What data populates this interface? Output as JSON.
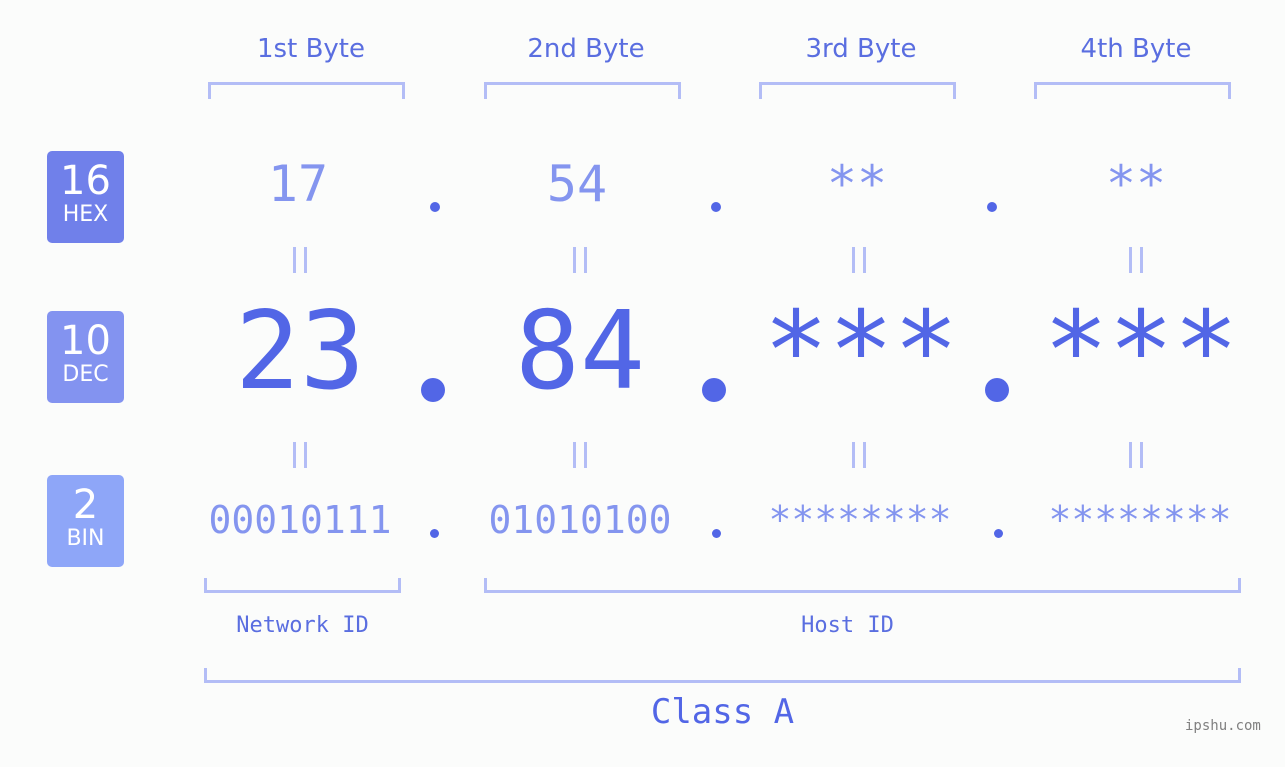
{
  "headers": [
    "1st Byte",
    "2nd Byte",
    "3rd Byte",
    "4th Byte"
  ],
  "badges": {
    "hex": {
      "num": "16",
      "label": "HEX",
      "color": "#7080ea"
    },
    "dec": {
      "num": "10",
      "label": "DEC",
      "color": "#8393f0"
    },
    "bin": {
      "num": "2",
      "label": "BIN",
      "color": "#8ea6f8"
    }
  },
  "hex": [
    "17",
    "54",
    "**",
    "**"
  ],
  "dec": [
    "23",
    "84",
    "***",
    "***"
  ],
  "bin": [
    "00010111",
    "01010100",
    "********",
    "********"
  ],
  "labels": {
    "network": "Network ID",
    "host": "Host ID",
    "class": "Class A"
  },
  "watermark": "ipshu.com",
  "colors": {
    "primary": "#5266e6",
    "light": "#8495ef",
    "bracket": "#b3bdf6"
  }
}
